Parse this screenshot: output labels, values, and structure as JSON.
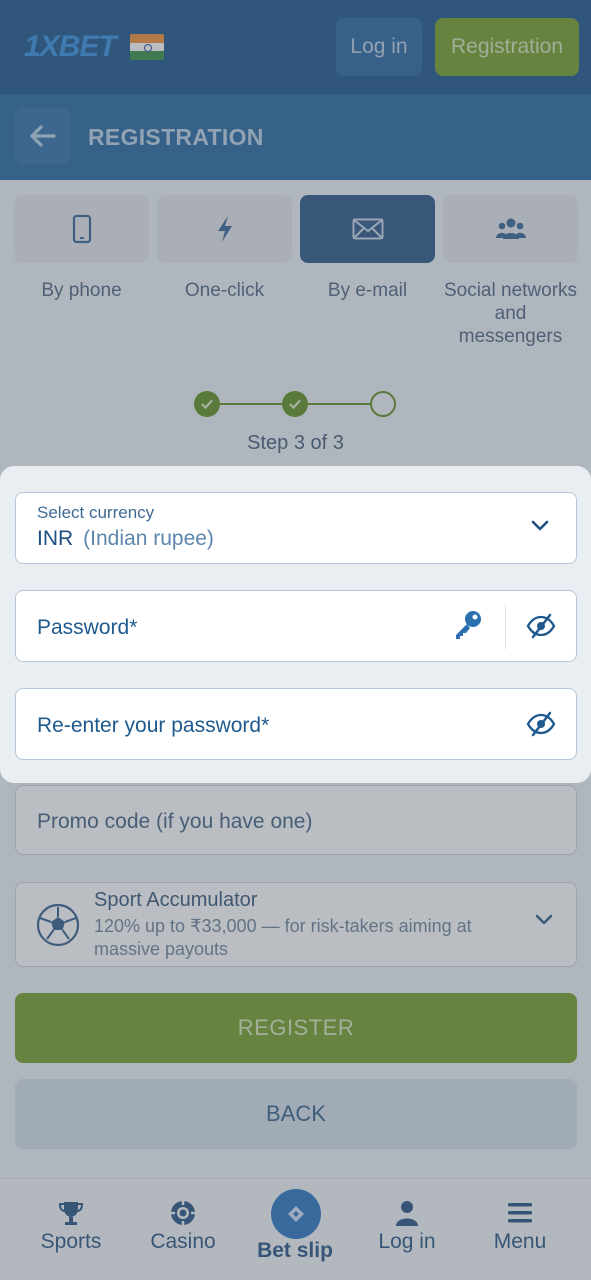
{
  "header": {
    "logo": "1XBET",
    "login_label": "Log in",
    "registration_label": "Registration"
  },
  "subheader": {
    "title": "REGISTRATION"
  },
  "tabs": [
    {
      "label": "By phone",
      "icon": "phone-icon",
      "active": false
    },
    {
      "label": "One-click",
      "icon": "lightning-icon",
      "active": false
    },
    {
      "label": "By e-mail",
      "icon": "envelope-icon",
      "active": true
    },
    {
      "label": "Social networks and messengers",
      "icon": "people-icon",
      "active": false
    }
  ],
  "stepper": {
    "current": 3,
    "total": 3,
    "text": "Step 3 of 3"
  },
  "form": {
    "currency_label": "Select currency",
    "currency_code": "INR",
    "currency_name": "(Indian rupee)",
    "password_placeholder": "Password*",
    "reenter_placeholder": "Re-enter your password*",
    "promo_placeholder": "Promo code (if you have one)",
    "bonus_title": "Sport Accumulator",
    "bonus_desc": "120% up to ₹33,000 — for risk-takers aiming at massive payouts"
  },
  "buttons": {
    "register": "REGISTER",
    "back": "BACK"
  },
  "bottom_nav": [
    {
      "label": "Sports",
      "icon": "trophy-icon"
    },
    {
      "label": "Casino",
      "icon": "casino-chip-icon"
    },
    {
      "label": "Bet slip",
      "icon": "ticket-icon"
    },
    {
      "label": "Log in",
      "icon": "user-icon"
    },
    {
      "label": "Menu",
      "icon": "hamburger-icon"
    }
  ],
  "colors": {
    "brand_blue": "#124d85",
    "accent_green": "#6f9b1c",
    "link_blue": "#1f6fc0"
  }
}
